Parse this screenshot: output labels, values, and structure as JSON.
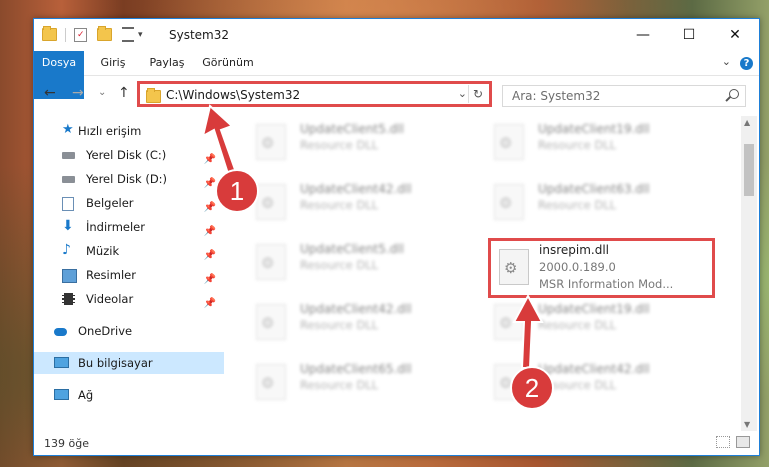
{
  "window": {
    "title": "System32",
    "controls": {
      "minimize": "—",
      "maximize": "☐",
      "close": "✕"
    }
  },
  "quick_access_toolbar": {
    "dropdown_glyph": "▾"
  },
  "ribbon": {
    "tabs": [
      "Dosya",
      "Giriş",
      "Paylaş",
      "Görünüm"
    ],
    "collapse_glyph": "⌄",
    "help_glyph": "?"
  },
  "navigation": {
    "back_glyph": "←",
    "forward_glyph": "→",
    "recent_glyph": "⌄",
    "up_glyph": "↑",
    "address": "C:\\Windows\\System32",
    "address_dropdown_glyph": "⌄",
    "refresh_glyph": "↻",
    "search_placeholder": "Ara: System32"
  },
  "sidebar": {
    "items": [
      {
        "label": "Hızlı erişim",
        "icon": "star-icon",
        "pinned": false,
        "selected": false
      },
      {
        "label": "Yerel Disk (C:)",
        "icon": "drive-icon",
        "pinned": true,
        "selected": false
      },
      {
        "label": "Yerel Disk (D:)",
        "icon": "drive-icon",
        "pinned": true,
        "selected": false
      },
      {
        "label": "Belgeler",
        "icon": "documents-icon",
        "pinned": true,
        "selected": false
      },
      {
        "label": "İndirmeler",
        "icon": "download-icon",
        "pinned": true,
        "selected": false
      },
      {
        "label": "Müzik",
        "icon": "music-icon",
        "pinned": true,
        "selected": false
      },
      {
        "label": "Resimler",
        "icon": "pictures-icon",
        "pinned": true,
        "selected": false
      },
      {
        "label": "Videolar",
        "icon": "videos-icon",
        "pinned": true,
        "selected": false
      },
      {
        "label": "OneDrive",
        "icon": "cloud-icon",
        "pinned": false,
        "selected": false
      },
      {
        "label": "Bu bilgisayar",
        "icon": "computer-icon",
        "pinned": false,
        "selected": true
      },
      {
        "label": "Ağ",
        "icon": "network-icon",
        "pinned": false,
        "selected": false
      }
    ],
    "pin_glyph": "📌"
  },
  "files": {
    "left_column": [
      {
        "name": "UpdateClient5.dll",
        "type": "Resource DLL"
      },
      {
        "name": "UpdateClient42.dll",
        "type": "Resource DLL"
      },
      {
        "name": "UpdateClient5.dll",
        "type": "Resource DLL"
      },
      {
        "name": "UpdateClient42.dll",
        "type": "Resource DLL"
      },
      {
        "name": "UpdateClient65.dll",
        "type": "Resource DLL"
      }
    ],
    "right_column": [
      {
        "name": "UpdateClient19.dll",
        "type": "Resource DLL"
      },
      {
        "name": "UpdateClient63.dll",
        "type": "Resource DLL"
      },
      {
        "name": "insrepim.dll",
        "version": "2000.0.189.0",
        "type": "MSR Information Mod...",
        "highlighted": true
      },
      {
        "name": "UpdateClient19.dll",
        "type": "Resource DLL"
      },
      {
        "name": "UpdateClient42.dll",
        "type": "Resource DLL"
      }
    ]
  },
  "status": {
    "item_count": "139 öğe"
  },
  "annotations": {
    "step1": "1",
    "step2": "2"
  },
  "colors": {
    "accent": "#1979ca",
    "highlight": "#e04b4b",
    "marker": "#d83b3b",
    "selected": "#cce8ff"
  }
}
